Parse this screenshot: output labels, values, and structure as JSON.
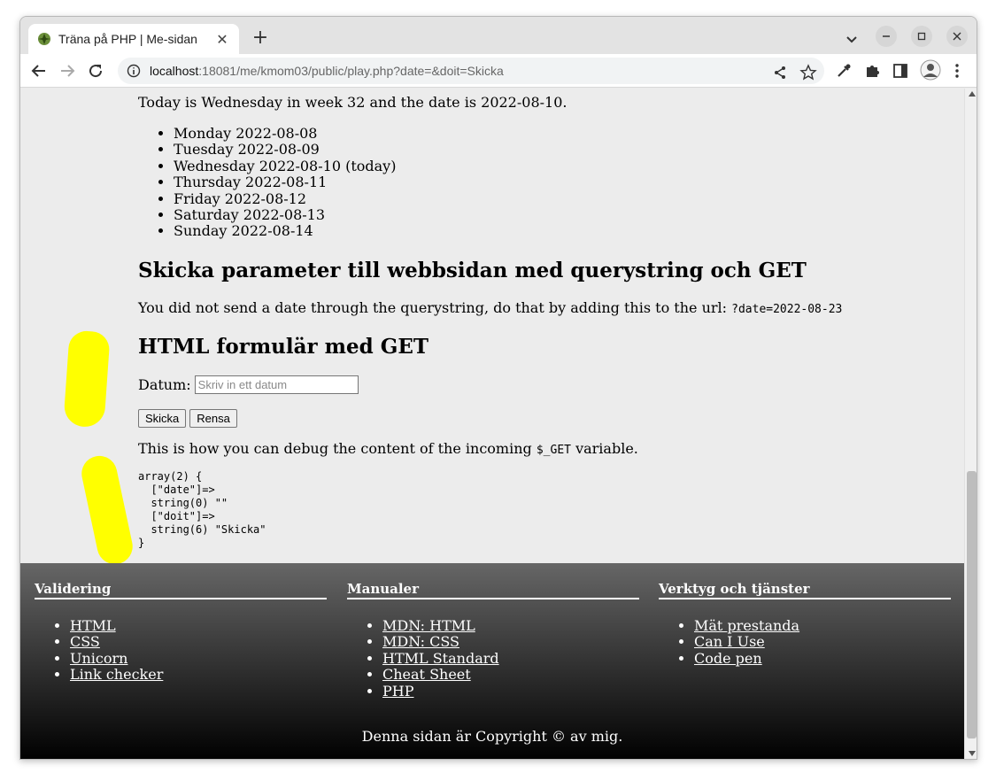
{
  "browser": {
    "tab_title": "Träna på PHP | Me-sidan",
    "tab_close": "✕",
    "new_tab": "+",
    "url_host": "localhost",
    "url_rest": ":18081/me/kmom03/public/play.php?date=&doit=Skicka"
  },
  "page": {
    "today_text": "Today is Wednesday in week 32 and the date is 2022-08-10.",
    "days": [
      "Monday 2022-08-08",
      "Tuesday 2022-08-09",
      "Wednesday 2022-08-10 (today)",
      "Thursday 2022-08-11",
      "Friday 2022-08-12",
      "Saturday 2022-08-13",
      "Sunday 2022-08-14"
    ],
    "heading_querystring": "Skicka parameter till webbsidan med querystring och GET",
    "querystring_text": "You did not send a date through the querystring, do that by adding this to the url: ",
    "querystring_code": "?date=2022-08-23",
    "heading_form": "HTML formulär med GET",
    "form_label": "Datum:",
    "form_placeholder": "Skriv in ett datum",
    "form_value": "",
    "submit_label": "Skicka",
    "reset_label": "Rensa",
    "debug_text_before": "This is how you can debug the content of the incoming ",
    "debug_code": "$_GET",
    "debug_text_after": " variable.",
    "dump": "array(2) {\n  [\"date\"]=>\n  string(0) \"\"\n  [\"doit\"]=>\n  string(6) \"Skicka\"\n}"
  },
  "footer": {
    "columns": [
      {
        "heading": "Validering",
        "links": [
          "HTML",
          "CSS",
          "Unicorn",
          "Link checker"
        ]
      },
      {
        "heading": "Manualer",
        "links": [
          "MDN: HTML",
          "MDN: CSS",
          "HTML Standard",
          "Cheat Sheet",
          "PHP"
        ]
      },
      {
        "heading": "Verktyg och tjänster",
        "links": [
          "Mät prestanda",
          "Can I Use",
          "Code pen"
        ]
      }
    ],
    "copyright": "Denna sidan är Copyright © av mig."
  },
  "colors": {
    "marker": "#ffff00",
    "page_background": "#ececec",
    "footer_gradient_top": "#666666",
    "footer_gradient_bottom": "#000000"
  }
}
